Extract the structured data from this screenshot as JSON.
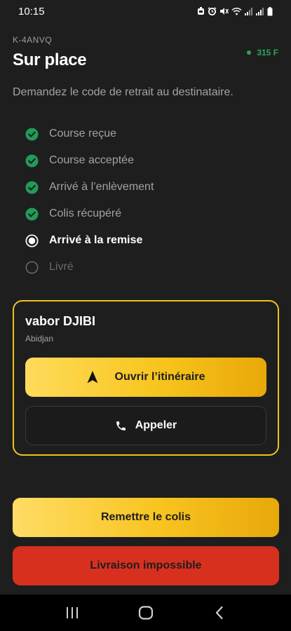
{
  "status_bar": {
    "time": "10:15"
  },
  "header": {
    "order_ref": "K-4ANVQ",
    "title": "Sur place",
    "connection_text": "315 F",
    "connection_color": "#2ea35a"
  },
  "instruction": "Demandez le code de retrait au destinataire.",
  "steps": [
    {
      "label": "Course reçue",
      "state": "done"
    },
    {
      "label": "Course acceptée",
      "state": "done"
    },
    {
      "label": "Arrivé à l’enlèvement",
      "state": "done"
    },
    {
      "label": "Colis récupéré",
      "state": "done"
    },
    {
      "label": "Arrivé à la remise",
      "state": "current"
    },
    {
      "label": "Livré",
      "state": "pending"
    }
  ],
  "recipient": {
    "name": "vabor DJIBI",
    "city": "Abidjan",
    "route_label": "Ouvrir l’itinéraire",
    "call_label": "Appeler"
  },
  "actions": {
    "handover_label": "Remettre le colis",
    "failed_label": "Livraison impossible"
  },
  "colors": {
    "accent": "#f7c51d",
    "danger": "#d8301f",
    "success": "#1f9d58",
    "background": "#1e1e1f"
  },
  "icons": {
    "route": "navigation-arrow-icon",
    "call": "phone-icon",
    "step_done": "check-circle-icon",
    "step_current": "radio-selected-icon",
    "step_pending": "radio-empty-icon"
  }
}
